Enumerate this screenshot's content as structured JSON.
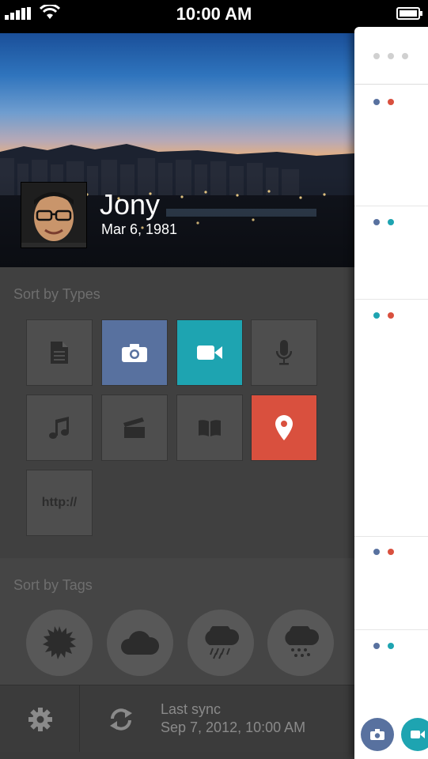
{
  "status_bar": {
    "time": "10:00 AM"
  },
  "profile": {
    "name": "Jony",
    "dob": "Mar 6, 1981"
  },
  "types": {
    "label": "Sort by Types",
    "tiles": [
      {
        "icon": "document-icon",
        "color": "#4e4e4e"
      },
      {
        "icon": "camera-icon",
        "color": "#58719f"
      },
      {
        "icon": "video-icon",
        "color": "#1ea4b1"
      },
      {
        "icon": "microphone-icon",
        "color": "#4e4e4e"
      },
      {
        "icon": "music-icon",
        "color": "#4e4e4e"
      },
      {
        "icon": "clapperboard-icon",
        "color": "#4e4e4e"
      },
      {
        "icon": "book-icon",
        "color": "#4e4e4e"
      },
      {
        "icon": "location-pin-icon",
        "color": "#d9503e"
      },
      {
        "icon": "link-icon",
        "color": "#4e4e4e",
        "text": "http://"
      }
    ]
  },
  "tags": {
    "label": "Sort by Tags",
    "items": [
      {
        "icon": "sun-icon"
      },
      {
        "icon": "cloud-icon"
      },
      {
        "icon": "rain-icon"
      },
      {
        "icon": "snow-icon"
      }
    ]
  },
  "sync": {
    "title": "Last sync",
    "time": "Sep 7, 2012, 10:00 AM"
  },
  "colors": {
    "blue": "#58719f",
    "teal": "#1ea4b1",
    "red": "#d9503e",
    "gray": "#d0d0d0"
  }
}
